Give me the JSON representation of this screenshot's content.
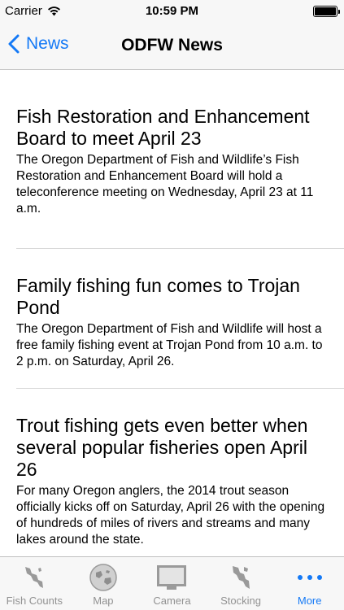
{
  "status_bar": {
    "carrier": "Carrier",
    "time": "10:59 PM"
  },
  "nav": {
    "back_label": "News",
    "title": "ODFW News"
  },
  "articles": [
    {
      "title": "Fish Restoration and Enhancement Board to meet April 23",
      "summary": "The Oregon Department of Fish and Wildlife’s Fish Restoration and Enhancement Board will hold a teleconference meeting on Wednesday, April 23 at 11 a.m."
    },
    {
      "title": "Family fishing fun comes to Trojan Pond",
      "summary": "The Oregon Department of Fish and Wildlife will host a free family fishing event at Trojan Pond from 10 a.m. to 2 p.m. on Saturday, April 26."
    },
    {
      "title": "Trout fishing gets even better when several popular fisheries open April 26",
      "summary": "For many Oregon anglers, the 2014 trout season officially kicks off on Saturday, April 26 with the opening of hundreds of miles of rivers and streams and many lakes around the state."
    }
  ],
  "tabs": [
    {
      "label": "Fish Counts",
      "icon": "river-map-icon"
    },
    {
      "label": "Map",
      "icon": "globe-icon"
    },
    {
      "label": "Camera",
      "icon": "camera-monitor-icon"
    },
    {
      "label": "Stocking",
      "icon": "stocking-map-icon"
    },
    {
      "label": "More",
      "icon": "more-dots-icon"
    }
  ],
  "colors": {
    "accent": "#1479f6",
    "inactive_tab": "#929292",
    "bar_background": "#f7f7f7"
  }
}
